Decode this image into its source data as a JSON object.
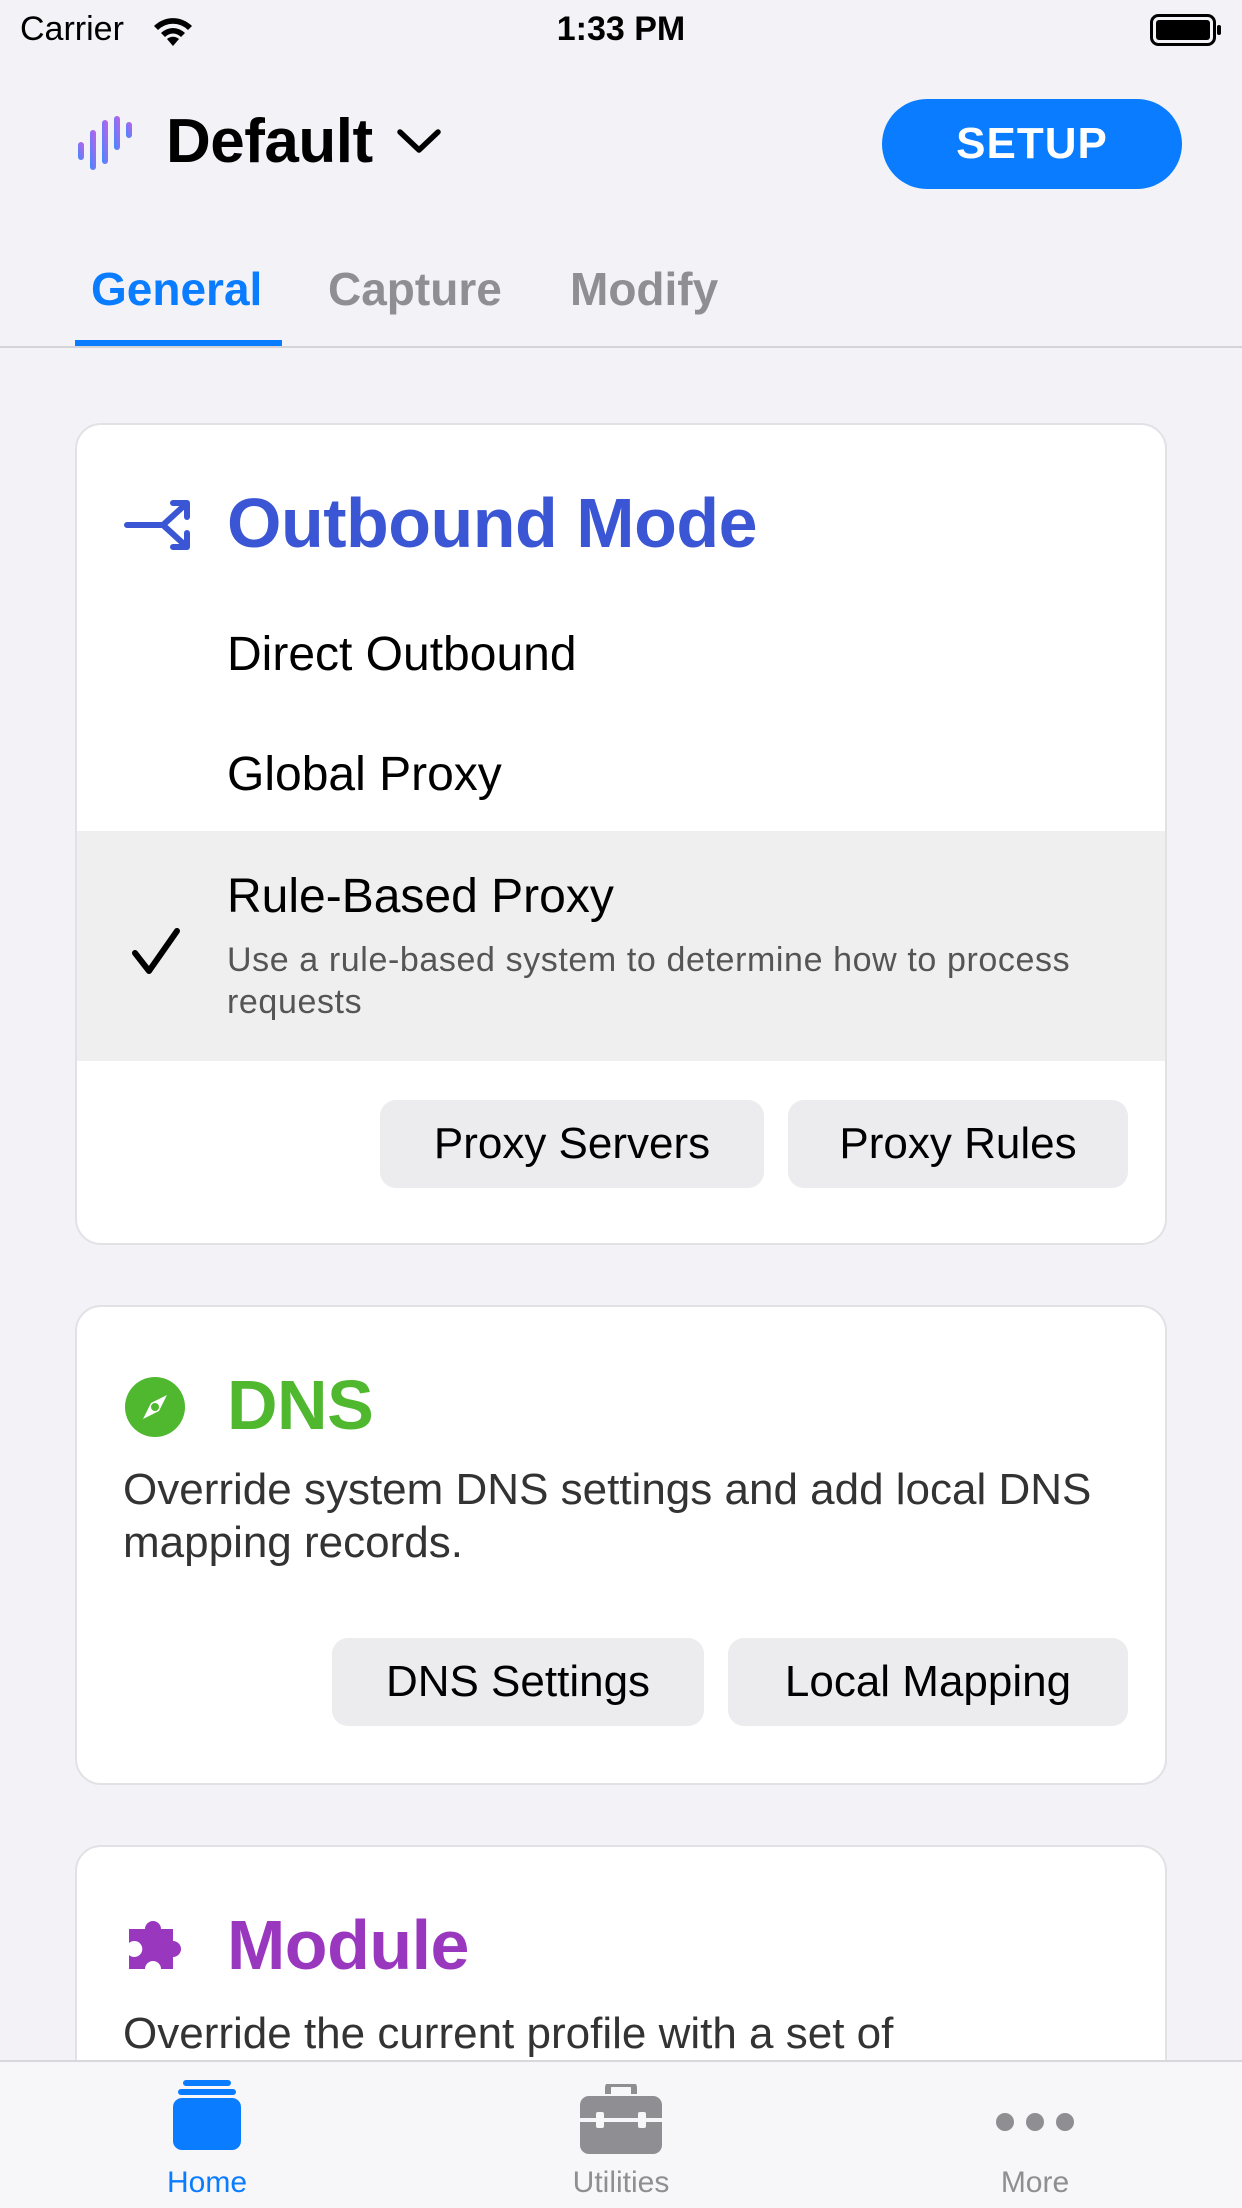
{
  "status_bar": {
    "carrier": "Carrier",
    "time": "1:33 PM"
  },
  "header": {
    "profile_name": "Default",
    "setup_label": "SETUP"
  },
  "tabs": [
    {
      "label": "General",
      "active": true
    },
    {
      "label": "Capture",
      "active": false
    },
    {
      "label": "Modify",
      "active": false
    }
  ],
  "outbound": {
    "title": "Outbound Mode",
    "options": [
      {
        "label": "Direct Outbound"
      },
      {
        "label": "Global Proxy"
      },
      {
        "label": "Rule-Based Proxy",
        "description": "Use a rule-based system to determine how to process requests",
        "selected": true
      }
    ],
    "buttons": {
      "proxy_servers": "Proxy Servers",
      "proxy_rules": "Proxy Rules"
    }
  },
  "dns": {
    "title": "DNS",
    "description": "Override system DNS settings and add local DNS mapping records.",
    "buttons": {
      "dns_settings": "DNS Settings",
      "local_mapping": "Local Mapping"
    }
  },
  "module": {
    "title": "Module",
    "description": "Override the current profile with a set of"
  },
  "tabbar": [
    {
      "label": "Home",
      "icon": "home-icon",
      "active": true
    },
    {
      "label": "Utilities",
      "icon": "toolbox-icon",
      "active": false
    },
    {
      "label": "More",
      "icon": "more-icon",
      "active": false
    }
  ],
  "colors": {
    "accent": "#0a7cff",
    "outbound": "#3b56d4",
    "dns": "#4fb82f",
    "module": "#9a37bf"
  }
}
